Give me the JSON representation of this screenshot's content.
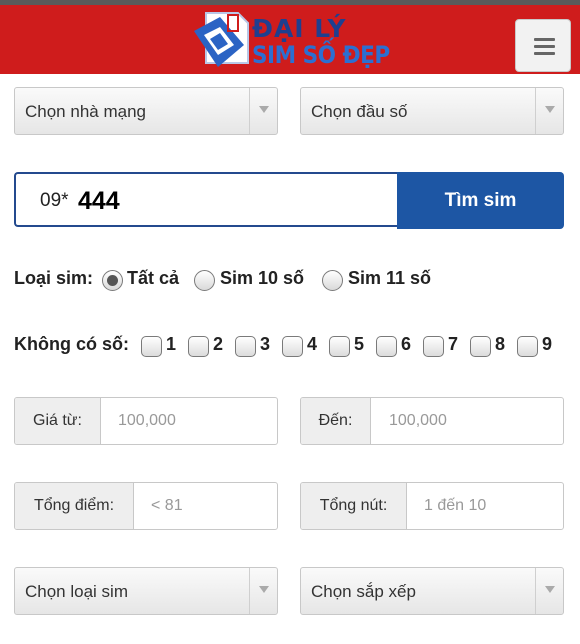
{
  "header": {
    "logo_line1": "ĐẠI LÝ",
    "logo_line2": "SIM SỐ ĐẸP",
    "menu_icon": "hamburger-menu-icon",
    "bg_color": "#cf1c1c"
  },
  "filters": {
    "network_select": "Chọn nhà mạng",
    "prefix_select": "Chọn đầu số"
  },
  "search": {
    "query_prefix": "09*",
    "query_bold": "444",
    "button_label": "Tìm sim",
    "button_color": "#1d56a4"
  },
  "sim_type": {
    "label": "Loại sim:",
    "options": [
      "Tất cả",
      "Sim 10 số",
      "Sim 11 số"
    ],
    "selected": "Tất cả"
  },
  "exclude_digits": {
    "label": "Không có số:",
    "digits": [
      "1",
      "2",
      "3",
      "4",
      "5",
      "6",
      "7",
      "8",
      "9"
    ]
  },
  "price": {
    "from_label": "Giá từ:",
    "from_placeholder": "100,000",
    "to_label": "Đến:",
    "to_placeholder": "100,000"
  },
  "score": {
    "total_label": "Tổng điểm:",
    "total_placeholder": "< 81",
    "nut_label": "Tổng nút:",
    "nut_placeholder": "1 đến 10"
  },
  "bottom_selects": {
    "sim_kind": "Chọn loại sim",
    "sort": "Chọn sắp xếp"
  }
}
